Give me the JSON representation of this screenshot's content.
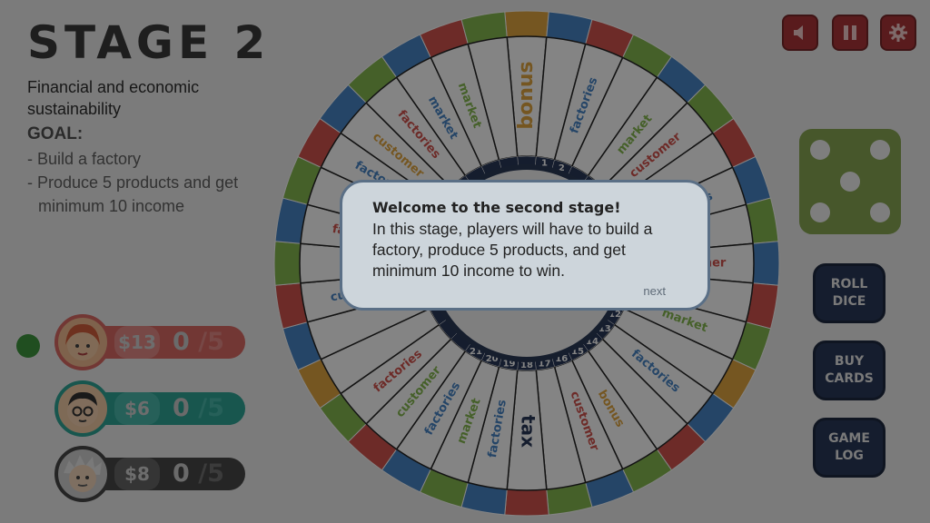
{
  "stage": {
    "title": "STAGE 2",
    "subtitle": "Financial and economic sustainability",
    "goal_label": "GOAL:",
    "goals": [
      "- Build a factory",
      "- Produce 5 products and get minimum 10 income"
    ]
  },
  "top_buttons": [
    {
      "name": "sound-button",
      "icon": "speaker-icon"
    },
    {
      "name": "pause-button",
      "icon": "pause-icon"
    },
    {
      "name": "settings-button",
      "icon": "gear-icon"
    }
  ],
  "dice": {
    "value": 5,
    "color": "#7fa246"
  },
  "actions": {
    "roll": "ROLL\nDICE",
    "buy": "BUY\nCARDS",
    "log": "GAME\nLOG"
  },
  "players": [
    {
      "money": "$13",
      "products": "0",
      "target": "/5",
      "color": "#c8504c",
      "active": true,
      "avatar": "red-hair-girl-avatar"
    },
    {
      "money": "$6",
      "products": "0",
      "target": "/5",
      "color": "#1c8e80",
      "active": false,
      "avatar": "glasses-boy-avatar"
    },
    {
      "money": "$8",
      "products": "0",
      "target": "/5",
      "color": "#4a4a4a",
      "active": false,
      "avatar": "grey-hair-man-avatar"
    }
  ],
  "board": {
    "center_labels": {
      "top": "bonus",
      "bottom": "tax"
    },
    "space_labels": [
      "factories",
      "market",
      "customer",
      "factories",
      "customer",
      "market",
      "factories",
      "bonus",
      "customer",
      "factories",
      "market",
      "factories",
      "customer",
      "factories",
      "customer",
      "factories",
      "market",
      "factories",
      "customer",
      "factories",
      "market",
      "market"
    ],
    "numbers": [
      "1",
      "2",
      "12",
      "13",
      "14",
      "15",
      "16",
      "17",
      "18",
      "19",
      "20",
      "21",
      "30",
      "31"
    ],
    "outer_icons": [
      "dollar-icon",
      "factory-icon",
      "cart-icon",
      "people-icon"
    ],
    "colors": {
      "yellow": "#e0a030",
      "blue": "#3a7cc2",
      "green": "#7cb342",
      "red": "#d0463f",
      "navy": "#17284b"
    }
  },
  "modal": {
    "title": "Welcome to the second stage!",
    "body": "In this stage, players will have to build a factory, produce 5 products, and get minimum 10 income to win.",
    "next": "next"
  }
}
